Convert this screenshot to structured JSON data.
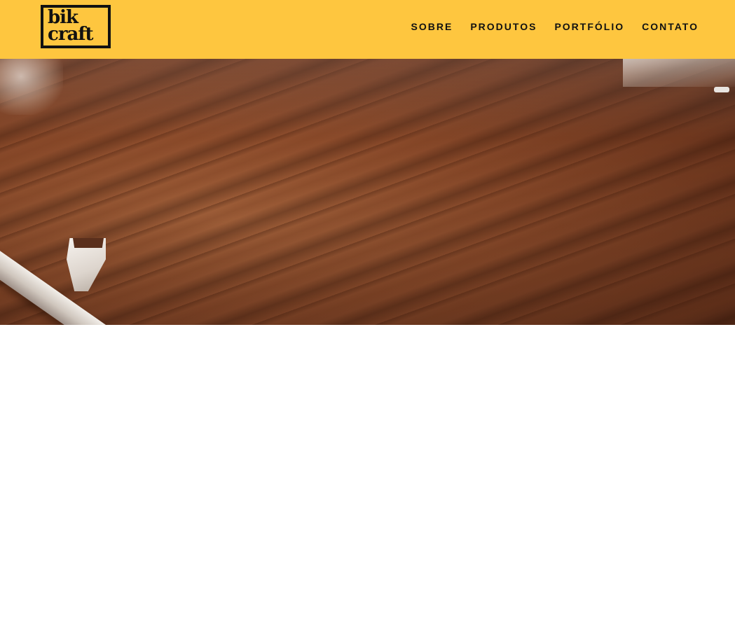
{
  "brand": {
    "logo_line1": "bik",
    "logo_line2": "craft",
    "header_color": "#FEC63F",
    "text_color": "#111111"
  },
  "nav": {
    "items": [
      {
        "label": "SOBRE"
      },
      {
        "label": "PRODUTOS"
      },
      {
        "label": "PORTFÓLIO"
      },
      {
        "label": "CONTATO"
      }
    ]
  },
  "hero": {
    "image_subject": "wood-grain-bike-part-photo"
  }
}
